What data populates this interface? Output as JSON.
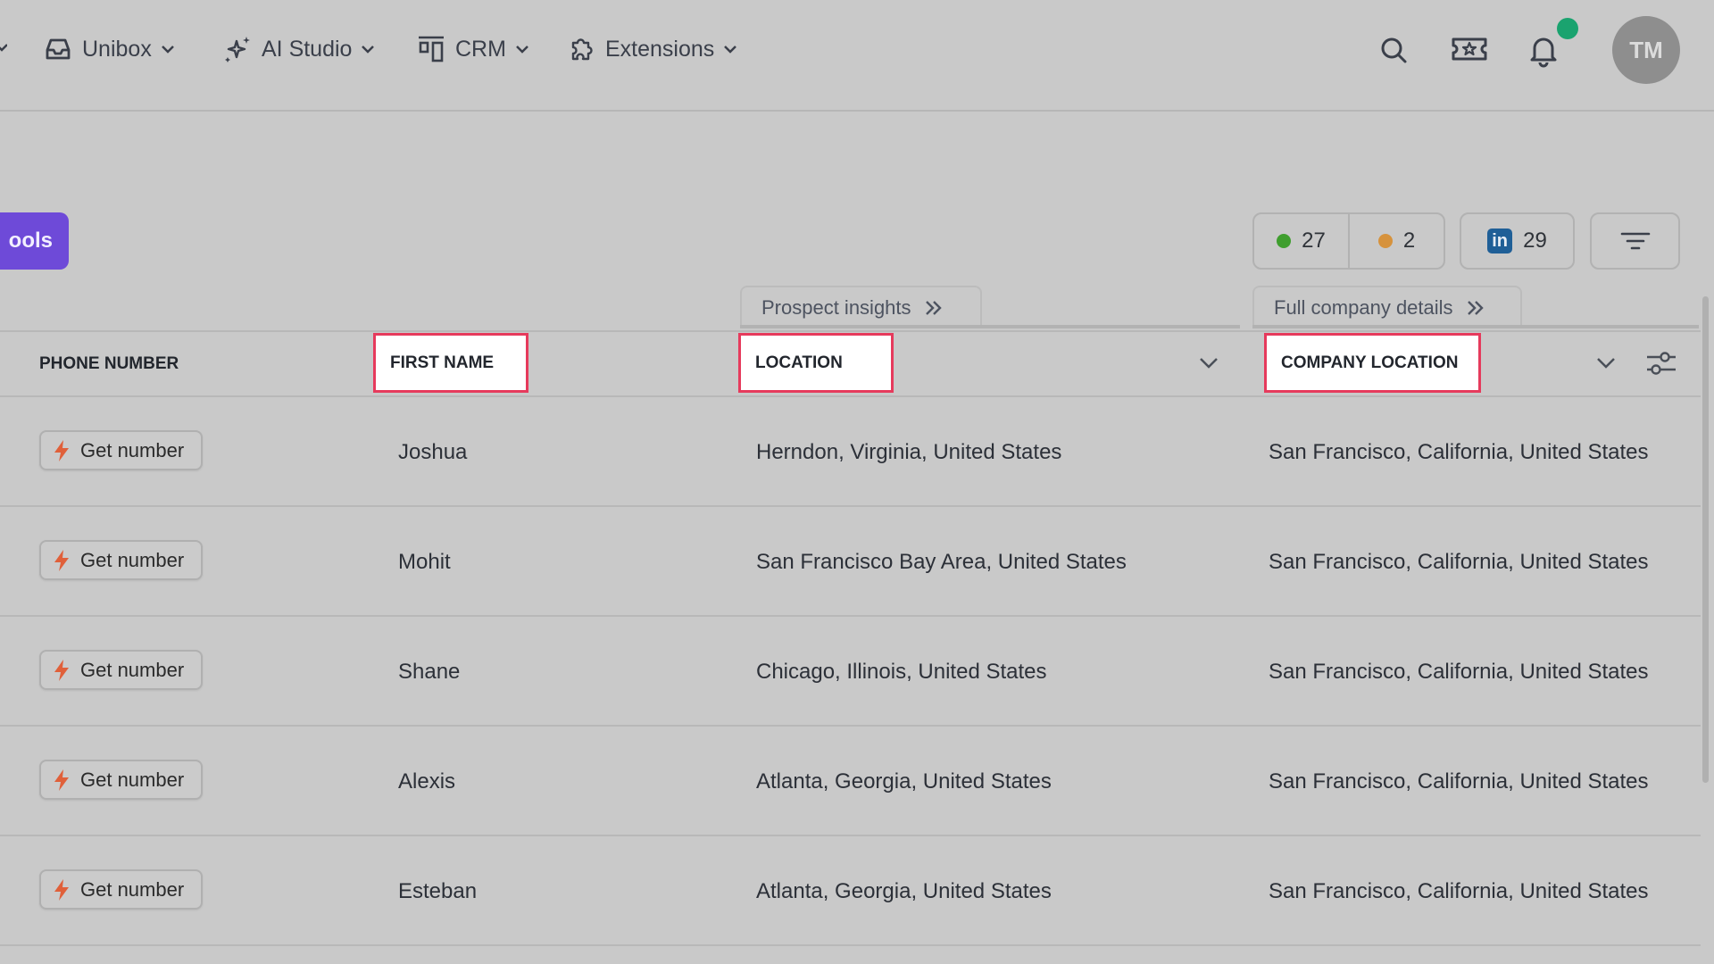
{
  "nav": {
    "items": [
      {
        "label": "Unibox",
        "icon": "inbox-icon"
      },
      {
        "label": "AI Studio",
        "icon": "sparkles-icon"
      },
      {
        "label": "CRM",
        "icon": "crm-icon"
      },
      {
        "label": "Extensions",
        "icon": "puzzle-icon"
      }
    ],
    "avatar_initials": "TM",
    "notification_dot_color": "#1aa36f"
  },
  "toolbar": {
    "tools_label": "ools",
    "tools_color": "#6e4ad8",
    "stat_green": "27",
    "stat_orange": "2",
    "stat_linkedin": "29",
    "linkedin_logo": "in",
    "green_color": "#3f9e2e",
    "orange_color": "#d6923c"
  },
  "groups": {
    "prospect_insights": "Prospect insights",
    "full_company_details": "Full company details"
  },
  "columns": {
    "phone": "PHONE NUMBER",
    "first_name": "FIRST NAME",
    "location": "LOCATION",
    "company_location": "COMPANY LOCATION"
  },
  "get_number_label": "Get number",
  "rows": [
    {
      "first_name": "Joshua",
      "location": "Herndon, Virginia, United States",
      "company_location": "San Francisco, California, United States"
    },
    {
      "first_name": "Mohit",
      "location": "San Francisco Bay Area, United States",
      "company_location": "San Francisco, California, United States"
    },
    {
      "first_name": "Shane",
      "location": "Chicago, Illinois, United States",
      "company_location": "San Francisco, California, United States"
    },
    {
      "first_name": "Alexis",
      "location": "Atlanta, Georgia, United States",
      "company_location": "San Francisco, California, United States"
    },
    {
      "first_name": "Esteban",
      "location": "Atlanta, Georgia, United States",
      "company_location": "San Francisco, California, United States"
    }
  ],
  "highlight_color": "#e63a5c"
}
